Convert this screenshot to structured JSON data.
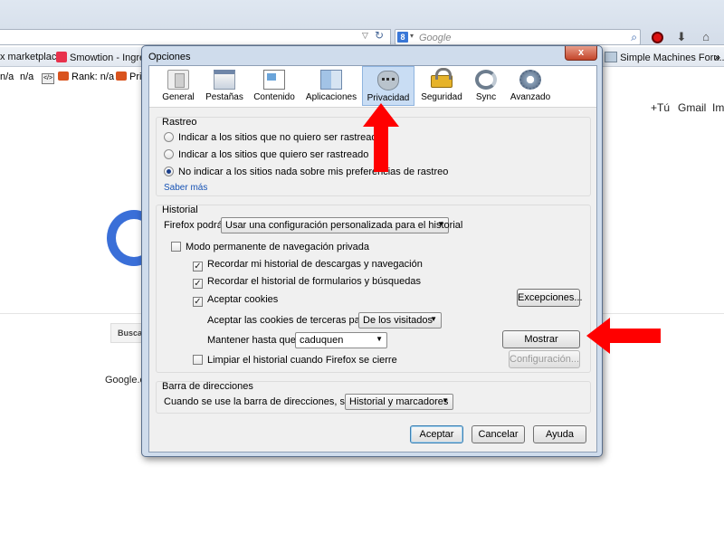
{
  "browser": {
    "search_placeholder": "Google",
    "search_engine_letter": "8",
    "bookmarks": [
      "x marketplace",
      "Smowtion - Ingres",
      "Simple Machines Foru..."
    ],
    "bookmarks2": [
      "n/a",
      "n/a",
      "Rank: n/a",
      "Pri"
    ],
    "code_icon_text": "</>"
  },
  "google_page": {
    "links": [
      "+Tú",
      "Gmail",
      "Imá"
    ],
    "search_button": "Busca",
    "footer": "Google.e"
  },
  "dialog": {
    "title": "Opciones",
    "close_label": "x",
    "tabs": [
      {
        "label": "General",
        "icon": "general-icon"
      },
      {
        "label": "Pestañas",
        "icon": "tabs-icon"
      },
      {
        "label": "Contenido",
        "icon": "content-icon"
      },
      {
        "label": "Aplicaciones",
        "icon": "applications-icon"
      },
      {
        "label": "Privacidad",
        "icon": "privacy-mask-icon",
        "active": true
      },
      {
        "label": "Seguridad",
        "icon": "padlock-icon"
      },
      {
        "label": "Sync",
        "icon": "sync-icon"
      },
      {
        "label": "Avanzado",
        "icon": "gear-icon"
      }
    ],
    "rastreo": {
      "title": "Rastreo",
      "options": [
        "Indicar a los sitios que no quiero ser rastreado",
        "Indicar a los sitios que quiero ser rastreado",
        "No indicar a los sitios nada sobre mis preferencias de rastreo"
      ],
      "selected_index": 2,
      "link": "Saber más"
    },
    "historial": {
      "title": "Historial",
      "firefox_label": "Firefox podrá:",
      "firefox_value": "Usar una configuración personalizada para el historial",
      "private_mode": "Modo permanente de navegación privada",
      "remember_downloads": "Recordar mi historial de descargas y navegación",
      "remember_forms": "Recordar el historial de formularios y búsquedas",
      "accept_cookies": "Aceptar cookies",
      "exceptions_button": "Excepciones...",
      "third_party_label": "Aceptar las cookies de terceras partes:",
      "third_party_value": "De los visitados",
      "keep_until_label": "Mantener hasta que:",
      "keep_until_value": "caduquen",
      "show_cookies_button": "Mostrar cookies...",
      "clear_history": "Limpiar el historial cuando Firefox se cierre",
      "settings_button": "Configuración..."
    },
    "barra": {
      "title": "Barra de direcciones",
      "label": "Cuando se use la barra de direcciones, sugerir:",
      "value": "Historial y marcadores"
    },
    "buttons": {
      "accept": "Aceptar",
      "cancel": "Cancelar",
      "help": "Ayuda"
    }
  },
  "colors": {
    "arrow": "#ff0000",
    "active_tab": "#c9ddf4",
    "link": "#1753b5"
  }
}
